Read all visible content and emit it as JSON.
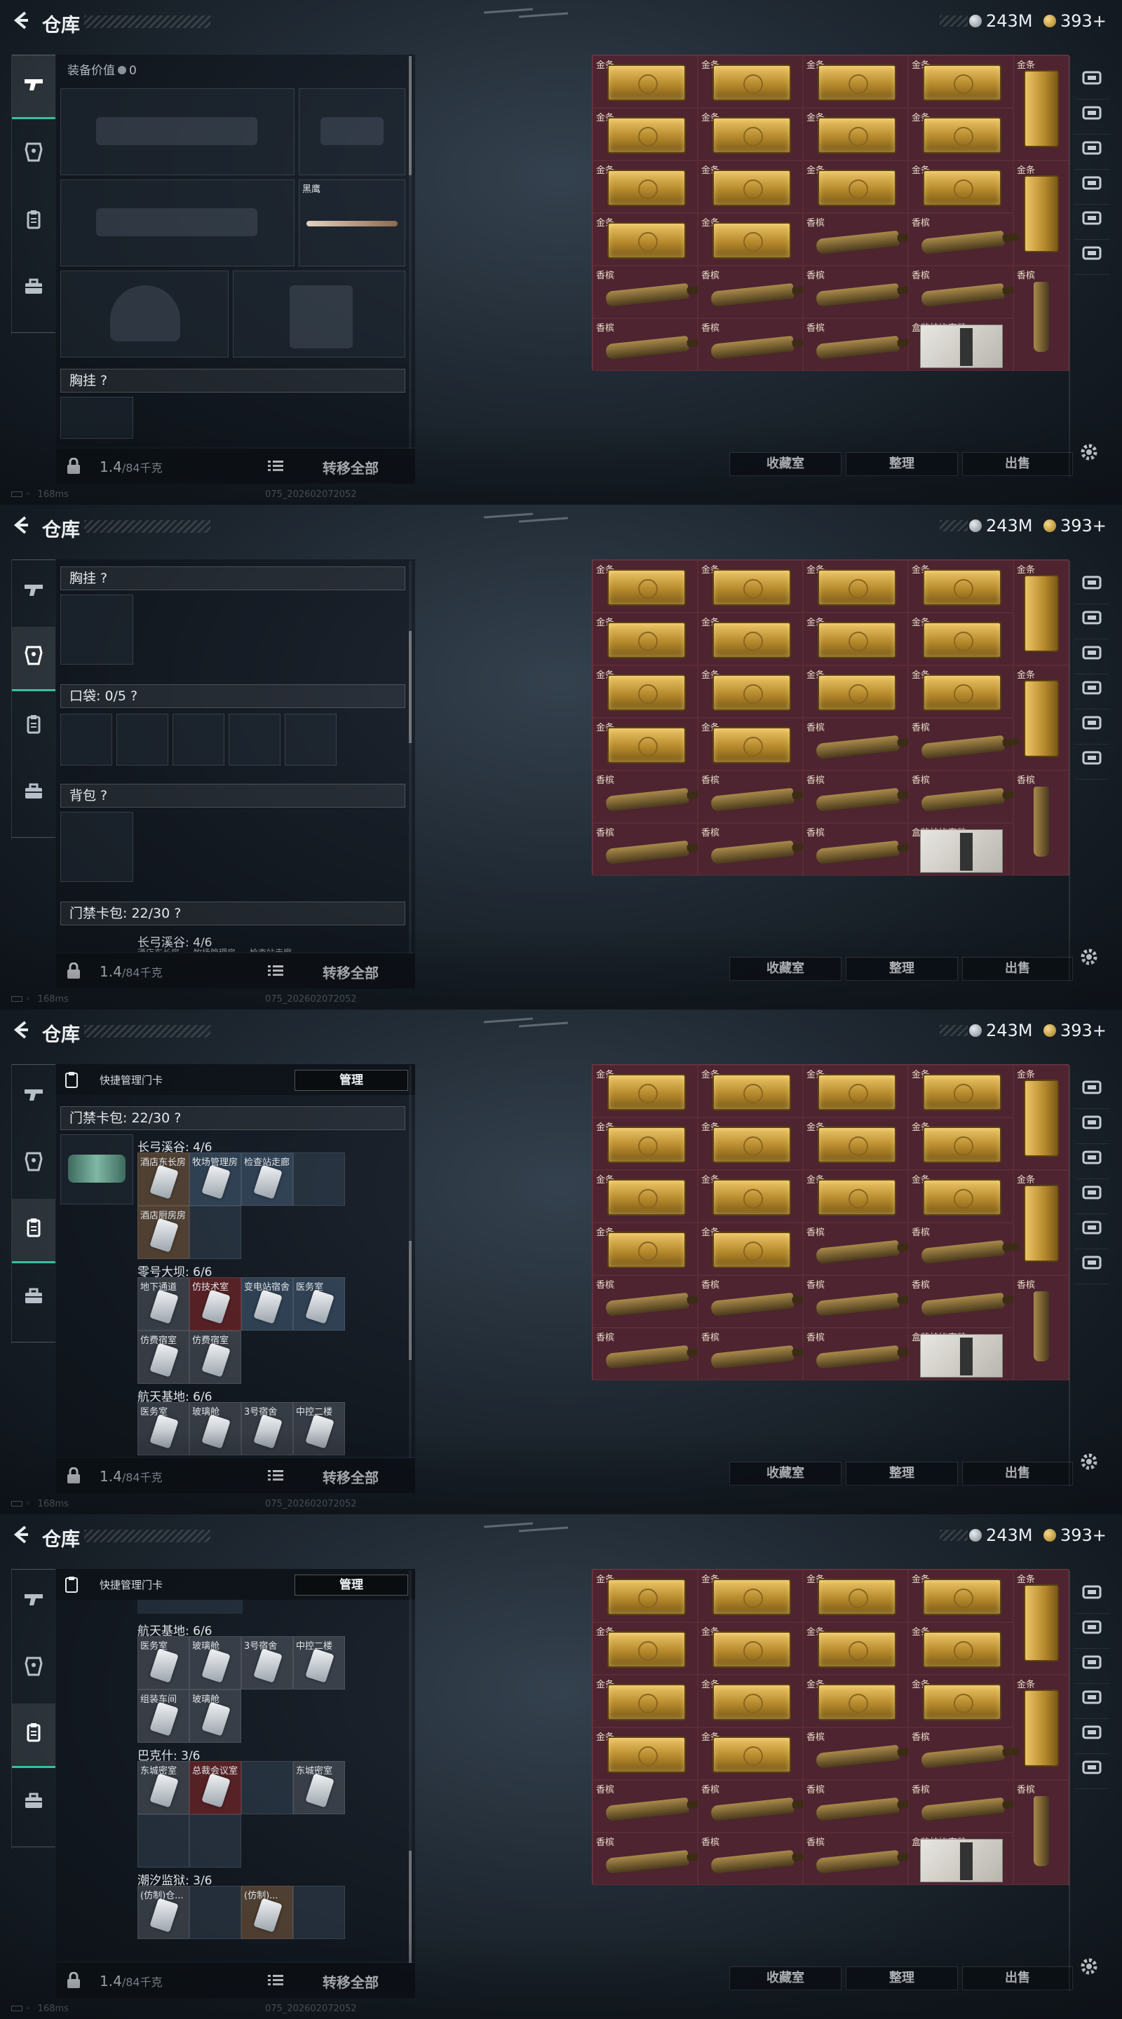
{
  "header": {
    "back": "<",
    "title": "仓库",
    "silver": "243M",
    "gold": "393+"
  },
  "bottom": {
    "weight": "1.4",
    "weight_unit": "/84千克",
    "move_all": "转移全部"
  },
  "stash_buttons": {
    "collection": "收藏室",
    "sort": "整理",
    "sell": "出售"
  },
  "status": {
    "ping": "168ms",
    "build": "075_202602072052"
  },
  "stash": {
    "gold_label": "金条",
    "cognac_label": "香槟",
    "gift_label": "盒装挂饰套装",
    "rows": [
      [
        "gold",
        "gold",
        "gold",
        "gold",
        "goldv"
      ],
      [
        "gold",
        "gold",
        "gold",
        "gold",
        ""
      ],
      [
        "gold",
        "gold",
        "gold",
        "gold",
        "goldv"
      ],
      [
        "gold",
        "gold",
        "cognac",
        "cognac",
        ""
      ],
      [
        "cognac",
        "cognac",
        "cognac",
        "cognac",
        "bottlev"
      ],
      [
        "cognac",
        "cognac",
        "cognac",
        "gift",
        ""
      ]
    ]
  },
  "frame1": {
    "equip_value_label": "装备价值",
    "equip_value": "0",
    "knife_name": "黑鹰",
    "chest_rig": "胸挂 ?"
  },
  "frame2": {
    "chest_rig": "胸挂 ?",
    "pockets": "口袋: 0/5 ?",
    "backpack": "背包 ?",
    "keycard_pack": "门禁卡包: 22/30 ?",
    "group1": "长弓溪谷: 4/6",
    "peek": [
      "酒店东长房",
      "牧场管理房",
      "检查站走廊"
    ]
  },
  "frame3": {
    "quick_manage": "快捷管理门卡",
    "manage": "管理",
    "keycard_pack": "门禁卡包: 22/30 ?",
    "groups": [
      {
        "name": "长弓溪谷: 4/6",
        "rows": [
          [
            {
              "l": "酒店东长房",
              "c": "tan"
            },
            {
              "l": "牧场管理房",
              "c": "blue"
            },
            {
              "l": "检查站走廊",
              "c": "blue"
            },
            {
              "l": "",
              "c": ""
            }
          ],
          [
            {
              "l": "酒店厨房房",
              "c": "tan"
            },
            {
              "l": "",
              "c": ""
            }
          ]
        ]
      },
      {
        "name": "零号大坝: 6/6",
        "rows": [
          [
            {
              "l": "地下通道",
              "c": "gray"
            },
            {
              "l": "仿技术室",
              "c": "red"
            },
            {
              "l": "变电站宿舍",
              "c": "blue"
            },
            {
              "l": "医务室",
              "c": "blue"
            }
          ],
          [
            {
              "l": "仿费宿室",
              "c": "gray"
            },
            {
              "l": "仿费宿室",
              "c": "gray"
            }
          ]
        ]
      },
      {
        "name": "航天基地: 6/6",
        "rows": [
          [
            {
              "l": "医务室",
              "c": "gray"
            },
            {
              "l": "玻璃舱",
              "c": "gray"
            },
            {
              "l": "3号宿舍",
              "c": "gray"
            },
            {
              "l": "中控二楼",
              "c": "gray"
            }
          ]
        ]
      }
    ]
  },
  "frame4": {
    "quick_manage": "快捷管理门卡",
    "manage": "管理",
    "groups": [
      {
        "name": "航天基地: 6/6",
        "rows": [
          [
            {
              "l": "医务室",
              "c": "gray"
            },
            {
              "l": "玻璃舱",
              "c": "gray"
            },
            {
              "l": "3号宿舍",
              "c": "gray"
            },
            {
              "l": "中控二楼",
              "c": "gray"
            }
          ],
          [
            {
              "l": "组装车间",
              "c": "gray"
            },
            {
              "l": "玻璃舱",
              "c": "gray"
            }
          ]
        ]
      },
      {
        "name": "巴克什: 3/6",
        "rows": [
          [
            {
              "l": "东城密室",
              "c": "gray"
            },
            {
              "l": "总裁会议室",
              "c": "red"
            },
            {
              "l": "",
              "c": ""
            },
            {
              "l": "东城密室",
              "c": "gray"
            }
          ],
          [
            {
              "l": "",
              "c": ""
            },
            {
              "l": "",
              "c": ""
            }
          ]
        ]
      },
      {
        "name": "潮汐监狱: 3/6",
        "rows": [
          [
            {
              "l": "(仿制)仓...",
              "c": "gray"
            },
            {
              "l": "",
              "c": ""
            },
            {
              "l": "(仿制)...",
              "c": "tan"
            },
            {
              "l": "",
              "c": ""
            }
          ]
        ]
      }
    ]
  }
}
